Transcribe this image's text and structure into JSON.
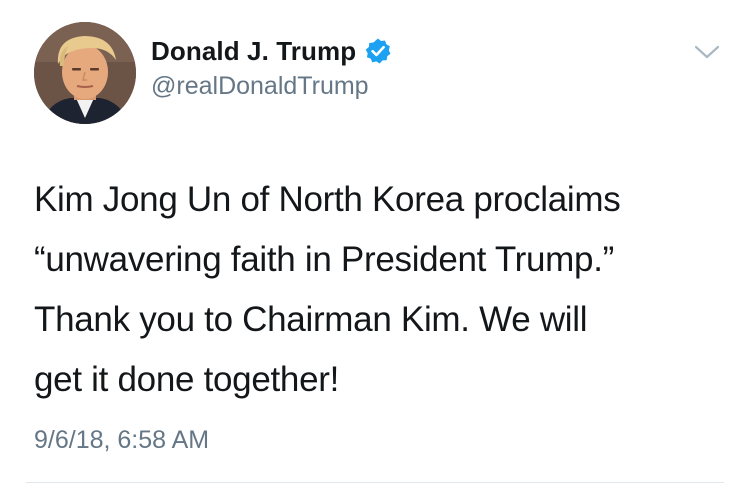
{
  "author": {
    "display_name": "Donald J. Trump",
    "handle": "@realDonaldTrump",
    "verified": true
  },
  "tweet": {
    "lines": [
      "Kim Jong Un of North Korea proclaims",
      "“unwavering faith in President Trump.”",
      "Thank you to Chairman Kim. We will",
      "get it done together!"
    ],
    "timestamp": "9/6/18, 6:58 AM"
  },
  "icons": {
    "avatar": "profile-photo",
    "verified": "verified-badge-icon",
    "menu": "chevron-down-icon"
  },
  "colors": {
    "name_text": "#14171a",
    "secondary_text": "#657786",
    "verified_blue": "#1da1f2",
    "divider": "#e1e8ed",
    "background": "#ffffff"
  }
}
